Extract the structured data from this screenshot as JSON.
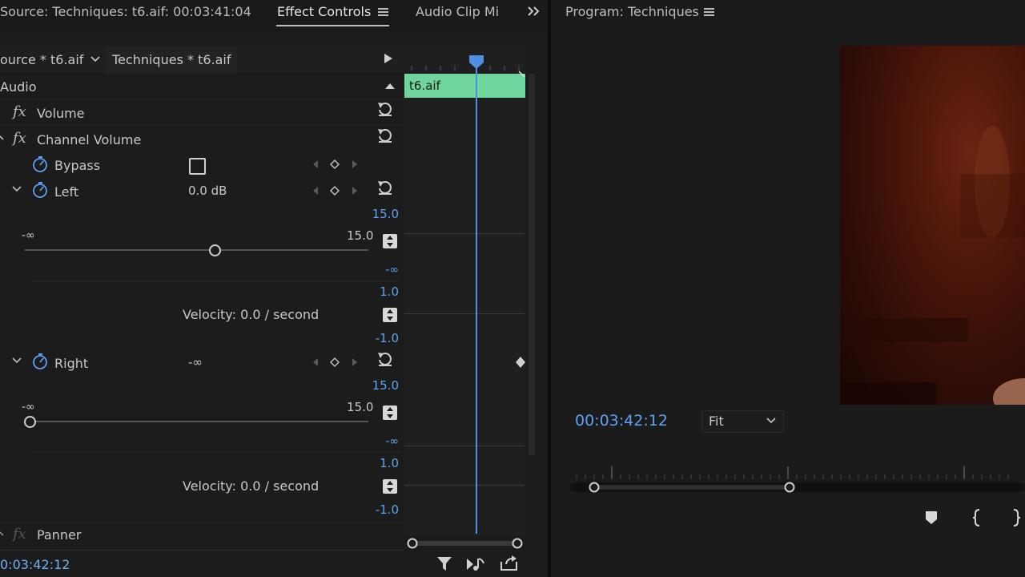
{
  "left_panel": {
    "source_tab": "Source: Techniques: t6.aif: 00:03:41:04",
    "effect_tab": "Effect Controls",
    "audio_tab": "Audio Clip Mi",
    "clip_source": "ource * t6.aif",
    "clip_seq": "Techniques * t6.aif",
    "section": "Audio",
    "volume": "Volume",
    "channel_volume": "Channel Volume",
    "bypass": "Bypass",
    "left": {
      "label": "Left",
      "value": "0.0 dB",
      "min": "-∞",
      "max": "15.0",
      "velocity": "Velocity: 0.0 / second",
      "graph_top": "15.0",
      "graph_bottom": "-∞",
      "vel_top": "1.0",
      "vel_bottom": "-1.0",
      "slider_fraction": 0.55
    },
    "right": {
      "label": "Right",
      "value": "-∞",
      "min": "-∞",
      "max": "15.0",
      "velocity": "Velocity: 0.0 / second",
      "graph_top": "15.0",
      "graph_bottom": "-∞",
      "vel_top": "1.0",
      "vel_bottom": "-1.0",
      "slider_fraction": 0.0
    },
    "panner": "Panner",
    "timecode": "0:03:42:12",
    "timeline_clip": "t6.aif"
  },
  "program": {
    "title": "Program: Techniques",
    "timecode": "00:03:42:12",
    "fit": "Fit"
  },
  "colors": {
    "accent": "#5ba3f2",
    "clip": "#6ed59c",
    "bg": "#1b1b1b"
  }
}
